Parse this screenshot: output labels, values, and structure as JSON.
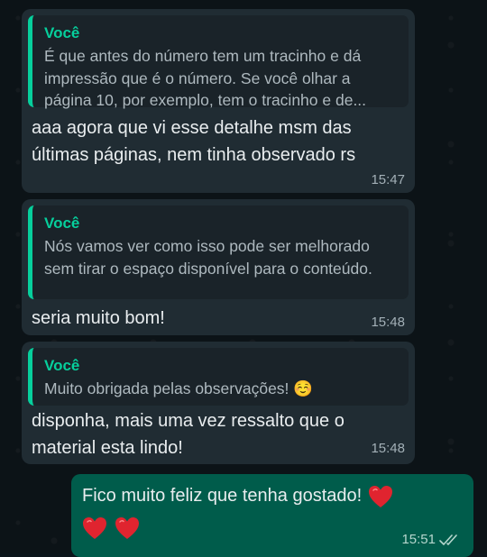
{
  "messages": [
    {
      "direction": "incoming",
      "quote_author": "Você",
      "quote_text": "É que antes do número tem um tracinho e dá impressão que é o número. Se você olhar a página 10, por exemplo, tem o tracinho e de...",
      "text": "aaa agora que vi esse detalhe msm das últimas páginas, nem tinha observado rs",
      "time": "15:47"
    },
    {
      "direction": "incoming",
      "quote_author": "Você",
      "quote_text": "Nós vamos ver como isso pode ser melhorado sem tirar o espaço disponível para o conteúdo.",
      "text": "seria muito bom!",
      "time": "15:48"
    },
    {
      "direction": "incoming",
      "quote_author": "Você",
      "quote_text": "Muito obrigada pelas observações! ☺️",
      "text": "disponha, mais uma vez ressalto que o material esta lindo!",
      "time": "15:48"
    },
    {
      "direction": "outgoing",
      "text": "Fico muito feliz que tenha gostado!",
      "time": "15:51",
      "status_icon": "double-check-icon"
    }
  ],
  "colors": {
    "incoming_bubble": "#202c33",
    "outgoing_bubble": "#005c4b",
    "quote_accent": "#06cf9c",
    "heart": "#e0242f"
  }
}
